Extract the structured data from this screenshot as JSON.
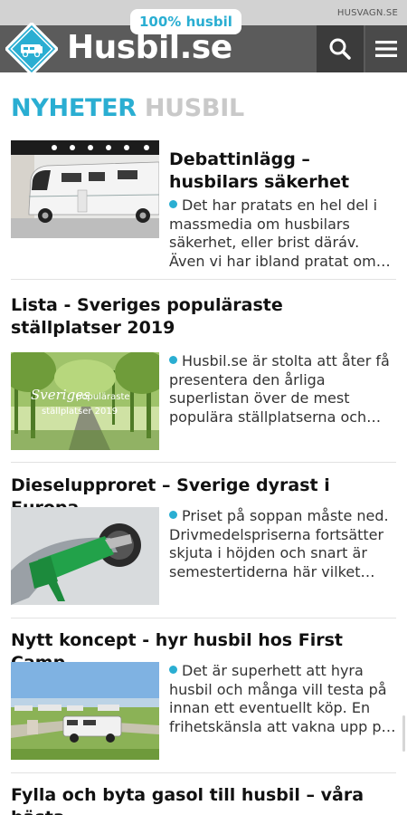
{
  "topbar": {
    "site_link": "HUSVAGN.SE"
  },
  "header": {
    "brand": "Husbil.se",
    "badge": "100% husbil",
    "search_icon": "search-icon",
    "menu_icon": "hamburger-menu-icon"
  },
  "section": {
    "title_main": "NYHETER",
    "title_sub": "HUSBIL"
  },
  "colors": {
    "accent": "#2aaed2",
    "header": "#5b5b5b",
    "header_dark": "#3b3b3b"
  },
  "articles": [
    {
      "title": "Debattinlägg – husbilars säkerhet",
      "excerpt": "Det har pratats en hel del i massmedia om husbilars säkerhet, eller brist däráv. Även vi har ibland pratat om…"
    },
    {
      "title": "Lista - Sveriges populäraste ställplatser 2019",
      "excerpt": "Husbil.se är stolta att åter få presentera den årliga superlistan över de mest populära ställplatserna och…",
      "image_text_1": "Sveriges",
      "image_text_2": "populäraste",
      "image_text_3": "ställplatser 2019"
    },
    {
      "title": "Dieselupproret – Sverige dyrast i Europa",
      "excerpt": "Priset på soppan måste ned. Drivmedelspriserna fortsätter skjuta i höjden och snart är semestertiderna här vilket…"
    },
    {
      "title": "Nytt koncept - hyr husbil hos First Camp",
      "excerpt": "Det är superhett att hyra husbil och många vill testa på innan ett eventuellt köp. En frihetskänsla att vakna upp p…"
    },
    {
      "title": "Fylla och byta gasol till husbil – våra bästa"
    }
  ]
}
